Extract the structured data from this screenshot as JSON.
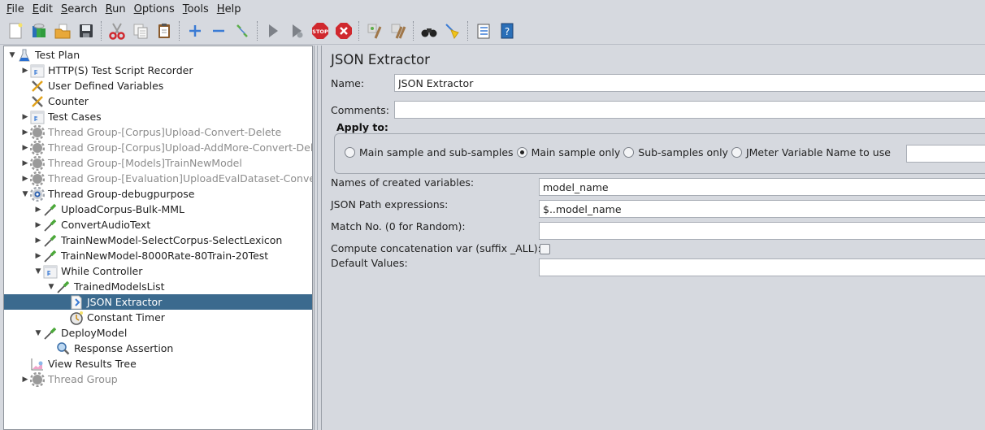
{
  "menu": [
    {
      "mnemonic": "F",
      "rest": "ile"
    },
    {
      "mnemonic": "E",
      "rest": "dit"
    },
    {
      "mnemonic": "S",
      "rest": "earch"
    },
    {
      "mnemonic": "R",
      "rest": "un"
    },
    {
      "mnemonic": "O",
      "rest": "ptions"
    },
    {
      "mnemonic": "T",
      "rest": "ools"
    },
    {
      "mnemonic": "H",
      "rest": "elp"
    }
  ],
  "toolbar": {
    "buttons": [
      "new-icon",
      "templates-icon",
      "open-icon",
      "save-icon",
      "cut-icon",
      "copy-icon",
      "paste-icon",
      "expand-icon",
      "collapse-icon",
      "toggle-icon",
      "start-icon",
      "start-no-pause-icon",
      "stop-icon",
      "shutdown-icon",
      "clear-icon",
      "clear-all-icon",
      "search-icon",
      "reset-search-icon",
      "function-helper-icon",
      "help-icon"
    ]
  },
  "tree": [
    {
      "label": "Test Plan",
      "icon": "test-plan-icon",
      "depth": 0,
      "toggle": "expanded",
      "disabled": false,
      "selected": false
    },
    {
      "label": "HTTP(S) Test Script Recorder",
      "icon": "controller-icon",
      "depth": 1,
      "toggle": "collapsed",
      "disabled": false,
      "selected": false
    },
    {
      "label": "User Defined Variables",
      "icon": "config-icon",
      "depth": 1,
      "toggle": "none",
      "disabled": false,
      "selected": false
    },
    {
      "label": "Counter",
      "icon": "config-icon",
      "depth": 1,
      "toggle": "none",
      "disabled": false,
      "selected": false
    },
    {
      "label": "Test Cases",
      "icon": "controller-icon",
      "depth": 1,
      "toggle": "collapsed",
      "disabled": false,
      "selected": false
    },
    {
      "label": "Thread Group-[Corpus]Upload-Convert-Delete",
      "icon": "thread-group-icon",
      "depth": 1,
      "toggle": "collapsed",
      "disabled": true,
      "selected": false
    },
    {
      "label": "Thread Group-[Corpus]Upload-AddMore-Convert-Delete",
      "icon": "thread-group-icon",
      "depth": 1,
      "toggle": "collapsed",
      "disabled": true,
      "selected": false
    },
    {
      "label": "Thread Group-[Models]TrainNewModel",
      "icon": "thread-group-icon",
      "depth": 1,
      "toggle": "collapsed",
      "disabled": true,
      "selected": false
    },
    {
      "label": "Thread Group-[Evaluation]UploadEvalDataset-Convert",
      "icon": "thread-group-icon",
      "depth": 1,
      "toggle": "collapsed",
      "disabled": true,
      "selected": false
    },
    {
      "label": "Thread Group-debugpurpose",
      "icon": "thread-group-active-icon",
      "depth": 1,
      "toggle": "expanded",
      "disabled": false,
      "selected": false
    },
    {
      "label": "UploadCorpus-Bulk-MML",
      "icon": "sampler-icon",
      "depth": 2,
      "toggle": "collapsed",
      "disabled": false,
      "selected": false
    },
    {
      "label": "ConvertAudioText",
      "icon": "sampler-icon",
      "depth": 2,
      "toggle": "collapsed",
      "disabled": false,
      "selected": false
    },
    {
      "label": "TrainNewModel-SelectCorpus-SelectLexicon",
      "icon": "sampler-icon",
      "depth": 2,
      "toggle": "collapsed",
      "disabled": false,
      "selected": false
    },
    {
      "label": "TrainNewModel-8000Rate-80Train-20Test",
      "icon": "sampler-icon",
      "depth": 2,
      "toggle": "collapsed",
      "disabled": false,
      "selected": false
    },
    {
      "label": "While Controller",
      "icon": "controller-icon",
      "depth": 2,
      "toggle": "expanded",
      "disabled": false,
      "selected": false
    },
    {
      "label": "TrainedModelsList",
      "icon": "sampler-icon",
      "depth": 3,
      "toggle": "expanded",
      "disabled": false,
      "selected": false
    },
    {
      "label": "JSON Extractor",
      "icon": "extractor-icon",
      "depth": 4,
      "toggle": "none",
      "disabled": false,
      "selected": true
    },
    {
      "label": "Constant Timer",
      "icon": "timer-icon",
      "depth": 4,
      "toggle": "none",
      "disabled": false,
      "selected": false
    },
    {
      "label": "DeployModel",
      "icon": "sampler-icon",
      "depth": 2,
      "toggle": "expanded",
      "disabled": false,
      "selected": false
    },
    {
      "label": "Response Assertion",
      "icon": "assertion-icon",
      "depth": 3,
      "toggle": "none",
      "disabled": false,
      "selected": false
    },
    {
      "label": "View Results Tree",
      "icon": "listener-icon",
      "depth": 1,
      "toggle": "none",
      "disabled": false,
      "selected": false
    },
    {
      "label": "Thread Group",
      "icon": "thread-group-icon",
      "depth": 1,
      "toggle": "collapsed",
      "disabled": true,
      "selected": false
    }
  ],
  "panel": {
    "title": "JSON Extractor",
    "name_label": "Name:",
    "name_value": "JSON Extractor",
    "comments_label": "Comments:",
    "comments_value": "",
    "apply_to_label": "Apply to:",
    "apply_options": [
      {
        "label": "Main sample and sub-samples",
        "checked": false
      },
      {
        "label": "Main sample only",
        "checked": true
      },
      {
        "label": "Sub-samples only",
        "checked": false
      },
      {
        "label": "JMeter Variable Name to use",
        "checked": false
      }
    ],
    "jmeter_variable_value": "",
    "fields": [
      {
        "label": "Names of created variables:",
        "value": "model_name"
      },
      {
        "label": "JSON Path expressions:",
        "value": "$..model_name"
      },
      {
        "label": "Match No. (0 for Random):",
        "value": ""
      }
    ],
    "concat_label": "Compute concatenation var (suffix _ALL):",
    "concat_checked": false,
    "default_label": "Default Values:",
    "default_value": ""
  }
}
